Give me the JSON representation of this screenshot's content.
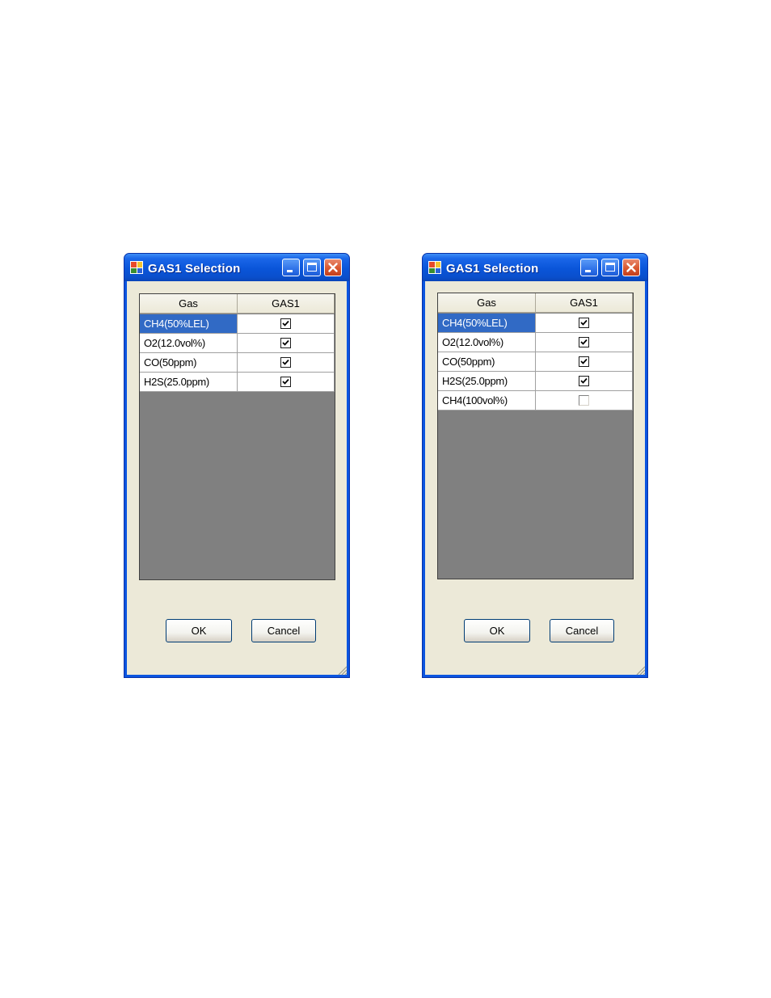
{
  "dialogs": [
    {
      "title": "GAS1 Selection",
      "columns": [
        "Gas",
        "GAS1"
      ],
      "rows": [
        {
          "name": "CH4(50%LEL)",
          "checked": true,
          "selected": true
        },
        {
          "name": "O2(12.0vol%)",
          "checked": true,
          "selected": false
        },
        {
          "name": "CO(50ppm)",
          "checked": true,
          "selected": false
        },
        {
          "name": "H2S(25.0ppm)",
          "checked": true,
          "selected": false
        }
      ],
      "ok_label": "OK",
      "cancel_label": "Cancel"
    },
    {
      "title": "GAS1 Selection",
      "columns": [
        "Gas",
        "GAS1"
      ],
      "rows": [
        {
          "name": "CH4(50%LEL)",
          "checked": true,
          "selected": true
        },
        {
          "name": "O2(12.0vol%)",
          "checked": true,
          "selected": false
        },
        {
          "name": "CO(50ppm)",
          "checked": true,
          "selected": false
        },
        {
          "name": "H2S(25.0ppm)",
          "checked": true,
          "selected": false
        },
        {
          "name": "CH4(100vol%)",
          "checked": false,
          "selected": false
        }
      ],
      "ok_label": "OK",
      "cancel_label": "Cancel"
    }
  ],
  "colors": {
    "titlebar": "#0a55d9",
    "selection": "#316ac5",
    "client": "#ece9d8",
    "grid_empty": "#808080",
    "close_button": "#d9582f"
  },
  "icons": {
    "app": "app-icon",
    "minimize": "minimize-icon",
    "maximize": "maximize-icon",
    "close": "close-icon",
    "checkbox": "checkbox",
    "resize": "resize-grip-icon"
  }
}
